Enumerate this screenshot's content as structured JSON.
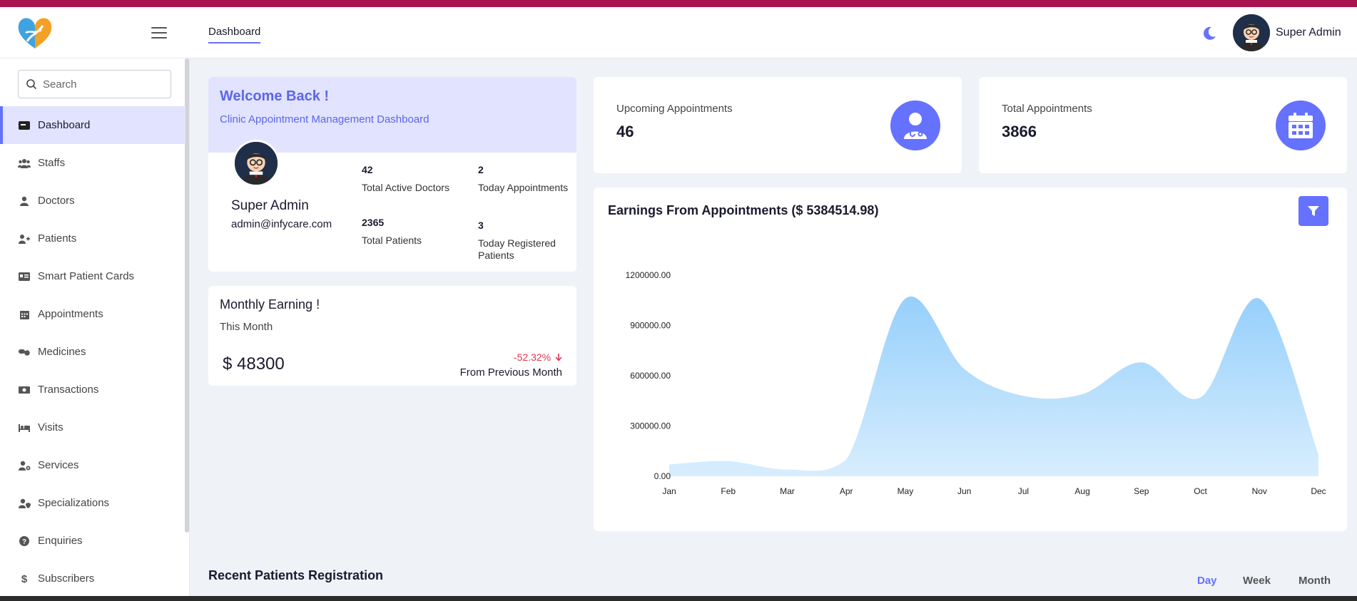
{
  "header": {
    "tab_label": "Dashboard",
    "user_name": "Super Admin"
  },
  "sidebar": {
    "search_placeholder": "Search",
    "items": [
      {
        "label": "Dashboard",
        "icon": "dashboard-icon",
        "active": true
      },
      {
        "label": "Staffs",
        "icon": "users-icon"
      },
      {
        "label": "Doctors",
        "icon": "doctor-icon"
      },
      {
        "label": "Patients",
        "icon": "patient-icon"
      },
      {
        "label": "Smart Patient Cards",
        "icon": "id-card-icon"
      },
      {
        "label": "Appointments",
        "icon": "calendar-icon"
      },
      {
        "label": "Medicines",
        "icon": "pills-icon"
      },
      {
        "label": "Transactions",
        "icon": "money-icon"
      },
      {
        "label": "Visits",
        "icon": "bed-icon"
      },
      {
        "label": "Services",
        "icon": "user-cog-icon"
      },
      {
        "label": "Specializations",
        "icon": "user-shield-icon"
      },
      {
        "label": "Enquiries",
        "icon": "question-icon"
      },
      {
        "label": "Subscribers",
        "icon": "dollar-icon"
      }
    ]
  },
  "welcome": {
    "title": "Welcome Back !",
    "subtitle": "Clinic Appointment Management Dashboard",
    "name": "Super Admin",
    "email": "admin@infycare.com",
    "stats": [
      {
        "value": "42",
        "label": "Total Active Doctors"
      },
      {
        "value": "2",
        "label": "Today Appointments"
      },
      {
        "value": "2365",
        "label": "Total Patients"
      },
      {
        "value": "3",
        "label": "Today Registered Patients"
      }
    ]
  },
  "monthly": {
    "title": "Monthly Earning !",
    "subtitle": "This Month",
    "amount": "$ 48300",
    "change": "-52.32%",
    "change_note": "From Previous Month",
    "change_color": "#e0364f"
  },
  "kpis": [
    {
      "label": "Upcoming Appointments",
      "value": "46",
      "icon": "doctor-icon"
    },
    {
      "label": "Total Appointments",
      "value": "3866",
      "icon": "calendar-icon"
    }
  ],
  "chart_data": {
    "type": "area",
    "title": "Earnings From Appointments ($ 5384514.98)",
    "categories": [
      "Jan",
      "Feb",
      "Mar",
      "Apr",
      "May",
      "Jun",
      "Jul",
      "Aug",
      "Sep",
      "Oct",
      "Nov",
      "Dec"
    ],
    "values": [
      70000,
      90000,
      40000,
      100000,
      1060000,
      640000,
      480000,
      490000,
      680000,
      470000,
      1060000,
      130000
    ],
    "yticks": [
      "0.00",
      "300000.00",
      "600000.00",
      "900000.00",
      "1200000.00"
    ],
    "ylim": [
      0,
      1200000
    ],
    "grid": false,
    "color": "#90cdfb"
  },
  "recent": {
    "title": "Recent Patients Registration",
    "periods": [
      "Day",
      "Week",
      "Month"
    ],
    "active_period": "Day"
  },
  "colors": {
    "accent": "#6571ff",
    "top_stripe": "#a8144f"
  }
}
